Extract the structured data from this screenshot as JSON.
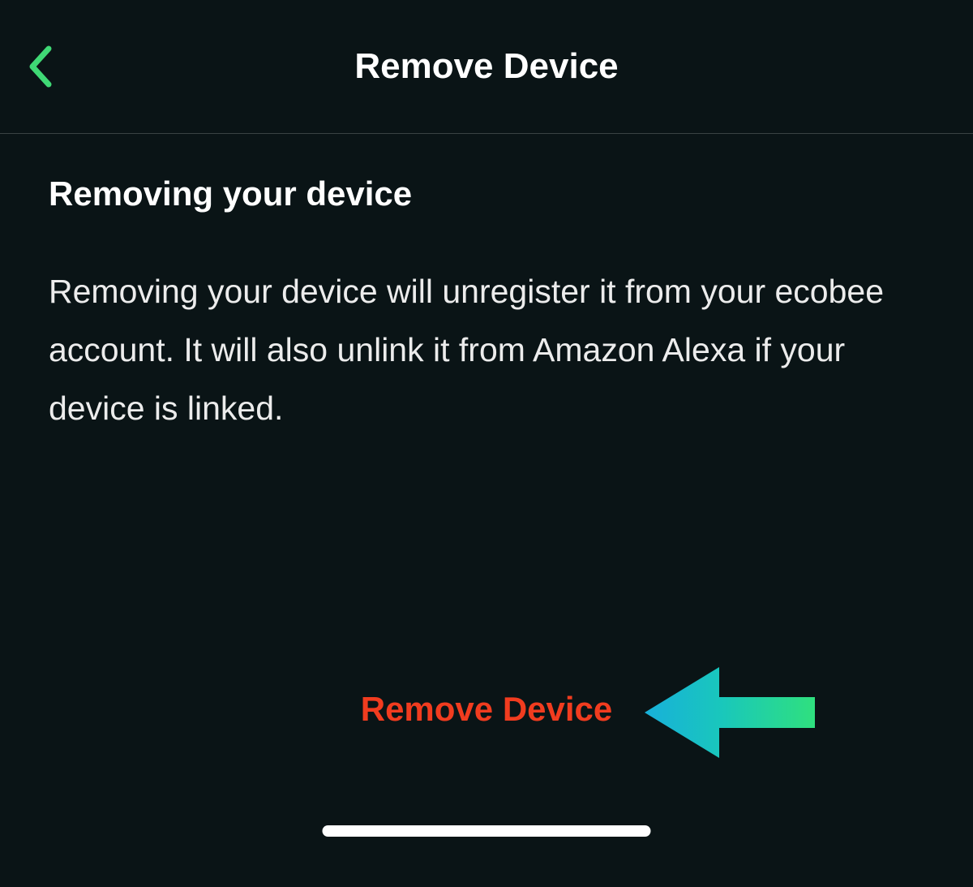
{
  "header": {
    "title": "Remove Device"
  },
  "content": {
    "heading": "Removing your device",
    "body": "Removing your device will unregister it from your ecobee account. It will also unlink it from Amazon Alexa if your device is linked."
  },
  "action": {
    "remove_label": "Remove Device"
  },
  "colors": {
    "accent_green": "#3fd975",
    "destructive_red": "#f13c1f",
    "background": "#0a1416"
  }
}
